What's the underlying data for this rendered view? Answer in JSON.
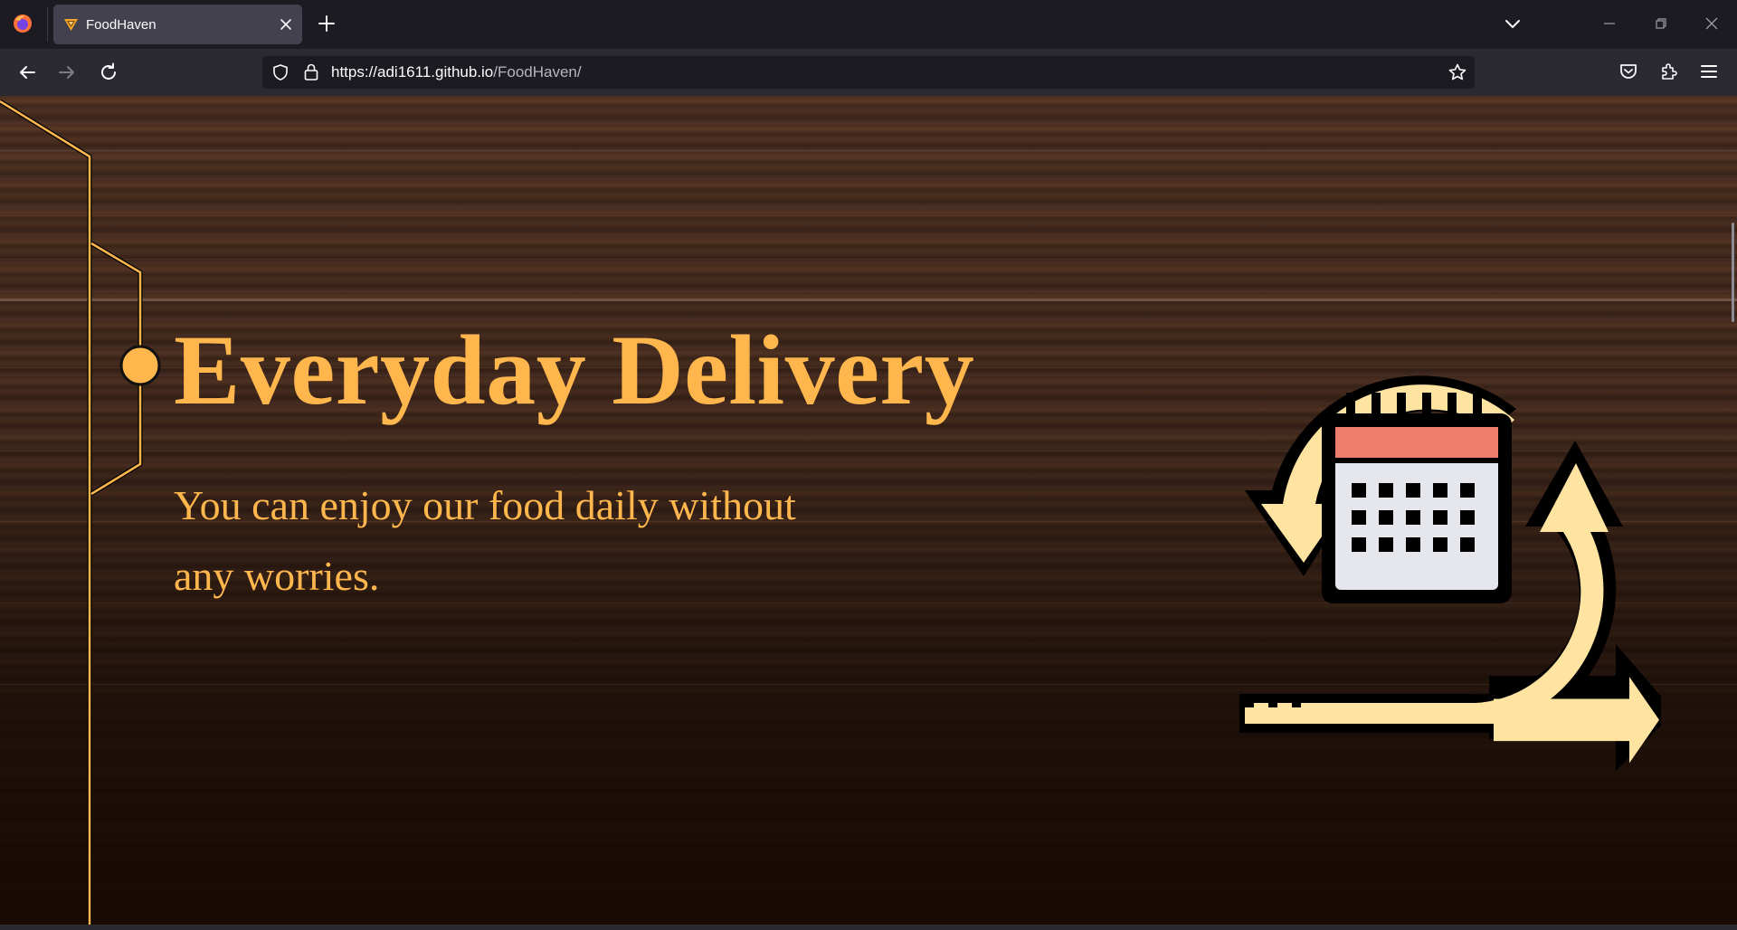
{
  "browser": {
    "tab": {
      "title": "FoodHaven"
    },
    "url": {
      "host": "https://adi1611.github.io",
      "path": "/FoodHaven/"
    }
  },
  "hero": {
    "title": "Everyday Delivery",
    "subtitle": "You can enjoy our food daily without any worries."
  },
  "colors": {
    "accent": "#ffb74d",
    "browser_dark": "#1c1b22",
    "browser_toolbar": "#2b2a33",
    "tab_active": "#42414d",
    "calendar_header": "#f07c6c",
    "calendar_body": "#e6e7ec",
    "arrow_fill": "#ffe3a1"
  },
  "icons": [
    "firefox-icon",
    "food-haven-favicon",
    "close-icon",
    "plus-icon",
    "chevron-down-icon",
    "minimize-icon",
    "restore-icon",
    "back-icon",
    "forward-icon",
    "reload-icon",
    "shield-icon",
    "lock-icon",
    "star-icon",
    "pocket-icon",
    "extensions-icon",
    "menu-icon",
    "daily-delivery-calendar-icon"
  ]
}
